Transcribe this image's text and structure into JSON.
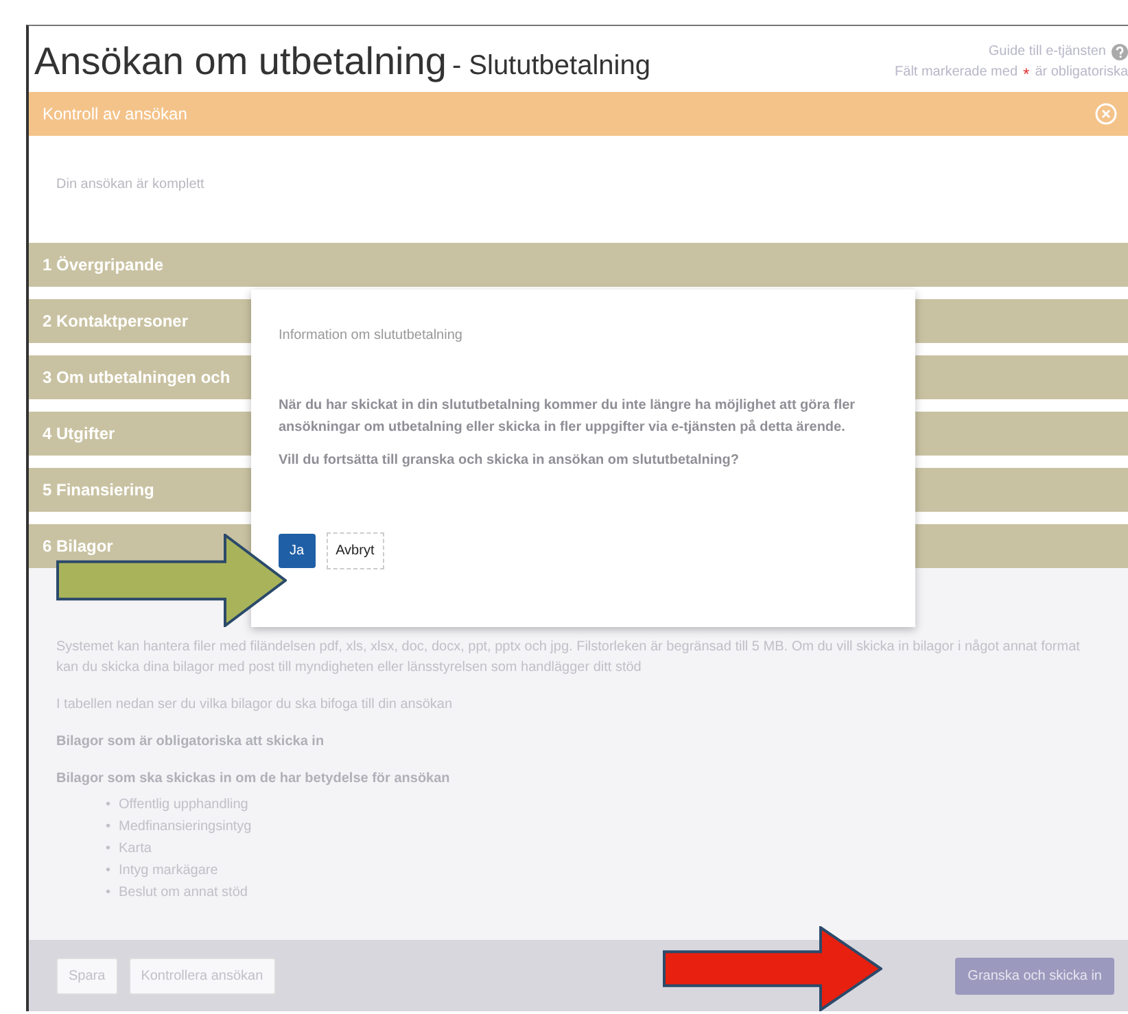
{
  "header": {
    "title": "Ansökan om utbetalning",
    "subtitle": "- Slututbetalning",
    "help_link": "Guide till e-tjänsten",
    "required_note_before": "Fält markerade med",
    "required_mark": "*",
    "required_note_after": "är obligatoriska"
  },
  "check_panel": {
    "title": "Kontroll av ansökan",
    "message": "Din ansökan är komplett"
  },
  "sections": [
    {
      "label": "1 Övergripande",
      "expanded": false
    },
    {
      "label": "2 Kontaktpersoner",
      "expanded": false
    },
    {
      "label": "3 Om utbetalningen och",
      "expanded": false
    },
    {
      "label": "4 Utgifter",
      "expanded": false
    },
    {
      "label": "5 Finansiering",
      "expanded": false
    },
    {
      "label": "6 Bilagor",
      "expanded": true
    }
  ],
  "attachments": {
    "file_text": "Systemet kan hantera filer med filändelsen pdf, xls, xlsx, doc, docx, ppt, pptx och jpg. Filstorleken är begränsad till 5 MB. Om du vill skicka in bilagor i något annat format kan du skicka dina bilagor med post till",
    "link_1": "myndigheten",
    "middle": "eller",
    "link_2": "länsstyrelsen",
    "file_text_end": "som handlägger ditt stöd",
    "table_intro": "I tabellen nedan ser du vilka bilagor du ska bifoga till din ansökan",
    "groups": [
      {
        "heading": "Bilagor som är obligatoriska att skicka in"
      },
      {
        "heading": "Bilagor som ska skickas in om de har betydelse för ansökan",
        "bullet": "•",
        "items": [
          "Offentlig upphandling",
          "Medfinansieringsintyg",
          "Karta",
          "Intyg markägare",
          "Beslut om annat stöd"
        ]
      }
    ]
  },
  "footer": {
    "buttons": [
      {
        "label": "Spara",
        "kind": "secondary"
      },
      {
        "label": "Kontrollera ansökan",
        "kind": "secondary"
      },
      {
        "label": "Granska och skicka in",
        "kind": "primary",
        "disabled": true
      }
    ]
  },
  "modal": {
    "title": "Information om slututbetalning",
    "paragraphs": [
      "När du har skickat in din slututbetalning kommer du inte längre ha möjlighet att göra fler ansökningar om utbetalning eller skicka in fler uppgifter via e-tjänsten på detta ärende.",
      "Vill du fortsätta till granska och skicka in ansökan om slututbetalning?"
    ],
    "buttons": [
      {
        "label": "Ja",
        "kind": "primary"
      },
      {
        "label": "Avbryt",
        "kind": "link"
      }
    ]
  },
  "annotations": [
    {
      "kind": "arrow",
      "color": "#a9b35a"
    },
    {
      "kind": "arrow",
      "color": "#e8200f"
    }
  ]
}
